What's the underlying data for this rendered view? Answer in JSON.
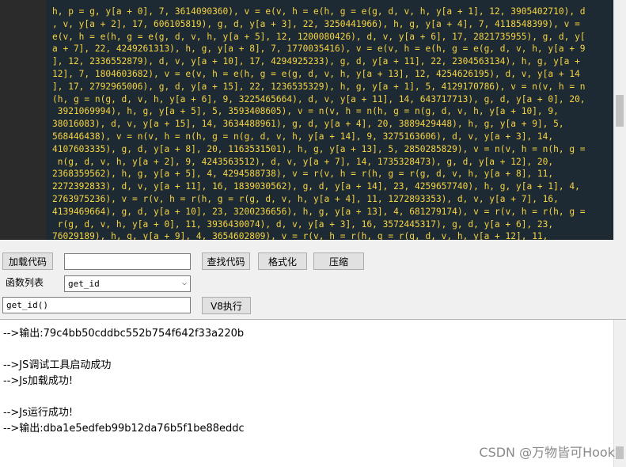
{
  "editor": {
    "lines": [
      "h, p = g, y[a + 0], 7, 3614090360), v = e(v, h = e(h, g = e(g, d, v, h, y[a + 1], 12, 3905402710), d",
      ", v, y[a + 2], 17, 606105819), g, d, y[a + 3], 22, 3250441966), h, g, y[a + 4], 7, 4118548399), v =",
      "e(v, h = e(h, g = e(g, d, v, h, y[a + 5], 12, 1200080426), d, v, y[a + 6], 17, 2821735955), g, d, y[",
      "a + 7], 22, 4249261313), h, g, y[a + 8], 7, 1770035416), v = e(v, h = e(h, g = e(g, d, v, h, y[a + 9",
      "], 12, 2336552879), d, v, y[a + 10], 17, 4294925233), g, d, y[a + 11], 22, 2304563134), h, g, y[a +",
      "12], 7, 1804603682), v = e(v, h = e(h, g = e(g, d, v, h, y[a + 13], 12, 4254626195), d, v, y[a + 14",
      "], 17, 2792965006), g, d, y[a + 15], 22, 1236535329), h, g, y[a + 1], 5, 4129170786), v = n(v, h = n",
      "(h, g = n(g, d, v, h, y[a + 6], 9, 3225465664), d, v, y[a + 11], 14, 643717713), g, d, y[a + 0], 20,",
      " 3921069994), h, g, y[a + 5], 5, 3593408605), v = n(v, h = n(h, g = n(g, d, v, h, y[a + 10], 9,",
      "38016083), d, v, y[a + 15], 14, 3634488961), g, d, y[a + 4], 20, 3889429448), h, g, y[a + 9], 5,",
      "568446438), v = n(v, h = n(h, g = n(g, d, v, h, y[a + 14], 9, 3275163606), d, v, y[a + 3], 14,",
      "4107603335), g, d, y[a + 8], 20, 1163531501), h, g, y[a + 13], 5, 2850285829), v = n(v, h = n(h, g =",
      " n(g, d, v, h, y[a + 2], 9, 4243563512), d, v, y[a + 7], 14, 1735328473), g, d, y[a + 12], 20,",
      "2368359562), h, g, y[a + 5], 4, 4294588738), v = r(v, h = r(h, g = r(g, d, v, h, y[a + 8], 11,",
      "2272392833), d, v, y[a + 11], 16, 1839030562), g, d, y[a + 14], 23, 4259657740), h, g, y[a + 1], 4,",
      "2763975236), v = r(v, h = r(h, g = r(g, d, v, h, y[a + 4], 11, 1272893353), d, v, y[a + 7], 16,",
      "4139469664), g, d, y[a + 10], 23, 3200236656), h, g, y[a + 13], 4, 681279174), v = r(v, h = r(h, g =",
      " r(g, d, v, h, y[a + 0], 11, 3936430074), d, v, y[a + 3], 16, 3572445317), g, d, y[a + 6], 23,",
      "76029189), h, g, y[a + 9], 4, 3654602809), v = r(v, h = r(h, g = r(g, d, v, h, y[a + 12], 11,",
      "3873151461), d, v, y[a + 15], 16, 530742520), g, d, y[a + 2], 23, 3299628645), h, g, y[a + 0], 6,"
    ]
  },
  "toolbar": {
    "load_code": "加载代码",
    "find_code": "查找代码",
    "format": "格式化",
    "compress": "压缩",
    "search_value": "",
    "function_list_label": "函数列表",
    "function_selected": "get_id",
    "call_value": "get_id()",
    "run_v8": "V8执行"
  },
  "output": {
    "lines": [
      "-->输出:79c4bb50cddbc552b754f642f33a220b",
      "",
      "-->JS调试工具启动成功",
      "-->Js加载成功!",
      "",
      "-->Js运行成功!",
      "-->输出:dba1e5edfeb99b12da76b5f1be88eddc"
    ]
  },
  "watermark": "CSDN @万物皆可Hook"
}
